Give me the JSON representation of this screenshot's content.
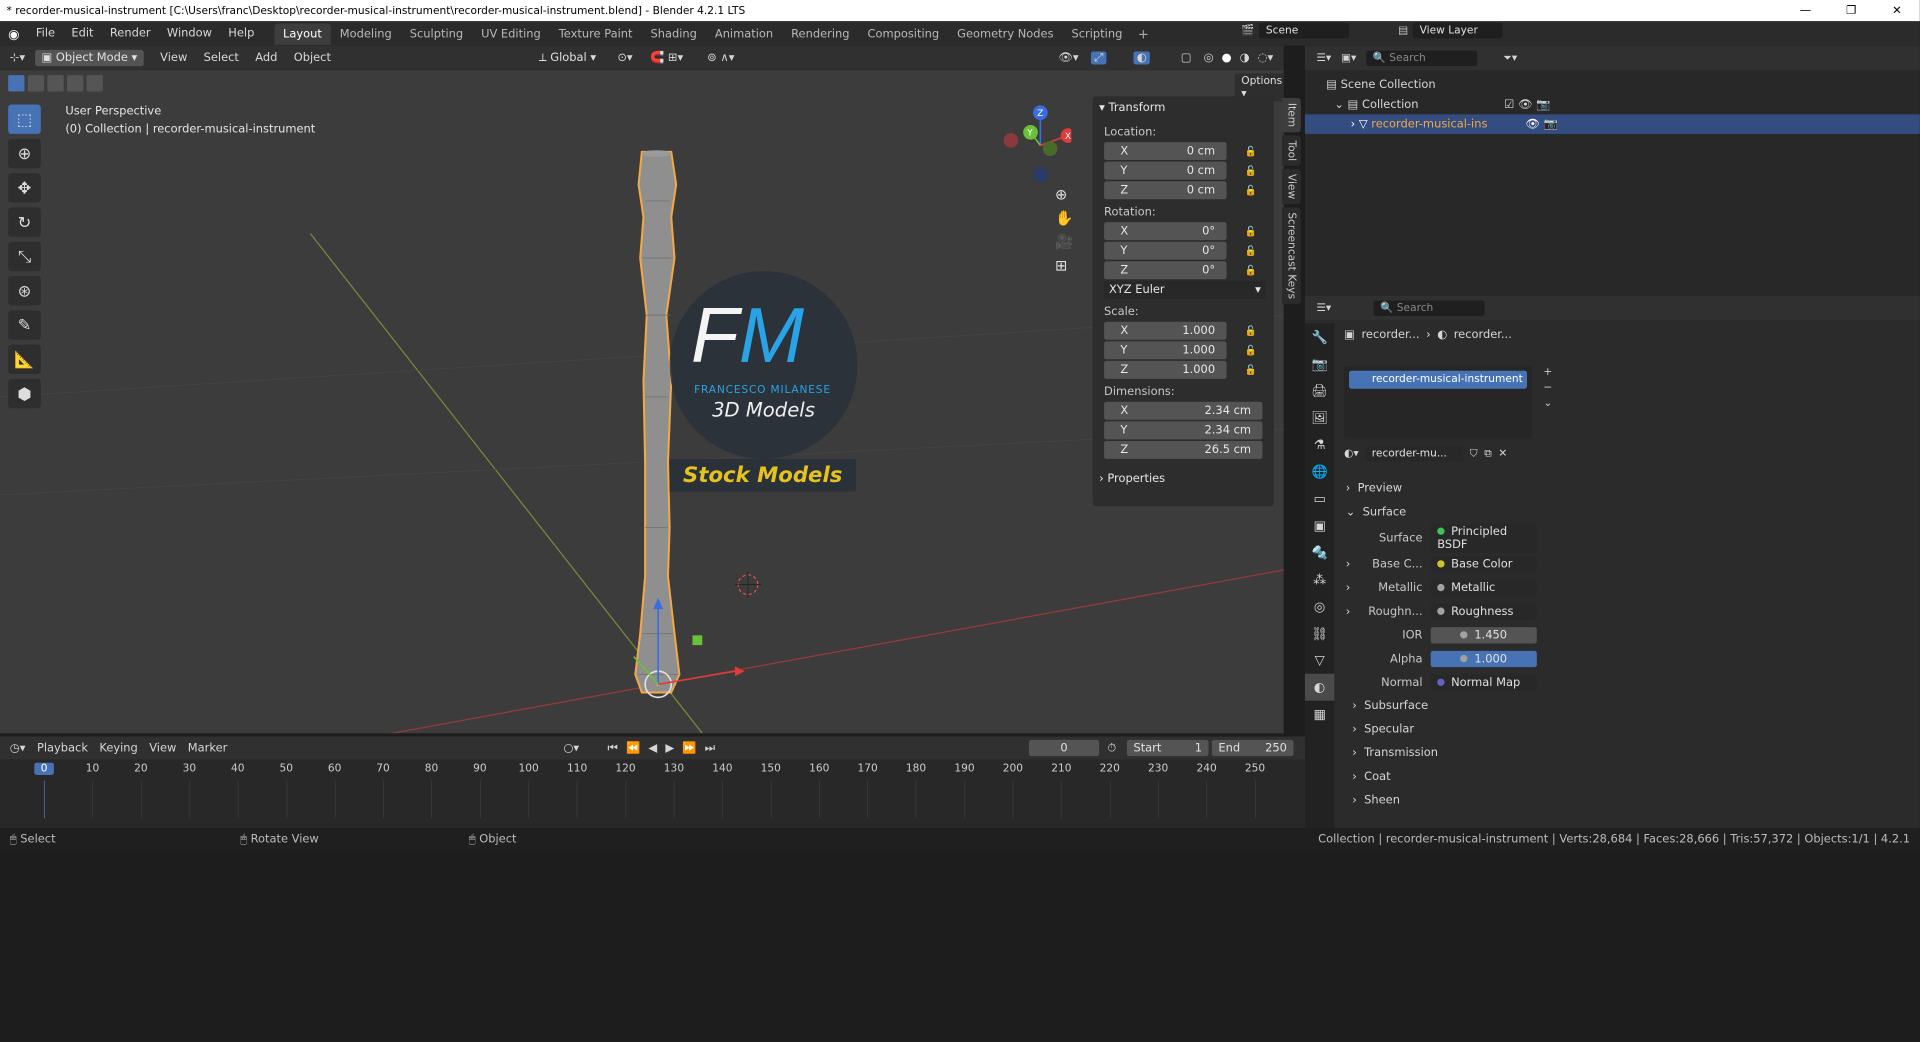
{
  "window": {
    "title": "* recorder-musical-instrument [C:\\Users\\franc\\Desktop\\recorder-musical-instrument\\recorder-musical-instrument.blend] - Blender 4.2.1 LTS",
    "min": "—",
    "max": "❐",
    "close": "✕"
  },
  "menu": [
    "File",
    "Edit",
    "Render",
    "Window",
    "Help"
  ],
  "workspaces": [
    "Layout",
    "Modeling",
    "Sculpting",
    "UV Editing",
    "Texture Paint",
    "Shading",
    "Animation",
    "Rendering",
    "Compositing",
    "Geometry Nodes",
    "Scripting"
  ],
  "active_workspace": "Layout",
  "scene": {
    "label": "Scene",
    "view_layer": "View Layer"
  },
  "viewport_header": {
    "mode": "Object Mode",
    "view": "View",
    "select": "Select",
    "add": "Add",
    "object": "Object",
    "transform": "Global",
    "options": "Options"
  },
  "viewport": {
    "perspective": "User Perspective",
    "collection_info": "(0) Collection | recorder-musical-instrument",
    "axis_x": "X",
    "axis_y": "Y",
    "axis_z": "Z"
  },
  "logo": {
    "initials_f": "F",
    "initials_m": "M",
    "name": "FRANCESCO MILANESE",
    "sub": "3D Models",
    "banner": "Stock Models"
  },
  "npanel": {
    "transform": "Transform",
    "location": "Location:",
    "loc": [
      {
        "axis": "X",
        "value": "0 cm"
      },
      {
        "axis": "Y",
        "value": "0 cm"
      },
      {
        "axis": "Z",
        "value": "0 cm"
      }
    ],
    "rotation": "Rotation:",
    "rot": [
      {
        "axis": "X",
        "value": "0°"
      },
      {
        "axis": "Y",
        "value": "0°"
      },
      {
        "axis": "Z",
        "value": "0°"
      }
    ],
    "rot_mode": "XYZ Euler",
    "scale": "Scale:",
    "scl": [
      {
        "axis": "X",
        "value": "1.000"
      },
      {
        "axis": "Y",
        "value": "1.000"
      },
      {
        "axis": "Z",
        "value": "1.000"
      }
    ],
    "dimensions": "Dimensions:",
    "dim": [
      {
        "axis": "X",
        "value": "2.34 cm"
      },
      {
        "axis": "Y",
        "value": "2.34 cm"
      },
      {
        "axis": "Z",
        "value": "26.5 cm"
      }
    ],
    "properties": "Properties",
    "tabs": [
      "Item",
      "Tool",
      "View",
      "Screencast Keys"
    ]
  },
  "outliner": {
    "search": "Search",
    "scene_collection": "Scene Collection",
    "collection": "Collection",
    "object": "recorder-musical-ins"
  },
  "properties": {
    "search": "Search",
    "breadcrumb_1": "recorder...",
    "breadcrumb_2": "recorder...",
    "material_slot": "recorder-musical-instrument",
    "material_name": "recorder-mu...",
    "preview": "Preview",
    "surface_section": "Surface",
    "surface_label": "Surface",
    "surface_value": "Principled BSDF",
    "rows": [
      {
        "label": "Base C...",
        "value": "Base Color",
        "socket": "#c7c729"
      },
      {
        "label": "Metallic",
        "value": "Metallic",
        "socket": "#a1a1a1"
      },
      {
        "label": "Roughn...",
        "value": "Roughness",
        "socket": "#a1a1a1"
      }
    ],
    "ior_label": "IOR",
    "ior_value": "1.450",
    "alpha_label": "Alpha",
    "alpha_value": "1.000",
    "normal_label": "Normal",
    "normal_value": "Normal Map",
    "sections": [
      "Subsurface",
      "Specular",
      "Transmission",
      "Coat",
      "Sheen"
    ]
  },
  "timeline": {
    "playback": "Playback",
    "keying": "Keying",
    "view": "View",
    "marker": "Marker",
    "current": "0",
    "start_label": "Start",
    "start": "1",
    "end_label": "End",
    "end": "250",
    "ticks": [
      "0",
      "10",
      "20",
      "30",
      "40",
      "50",
      "60",
      "70",
      "80",
      "90",
      "100",
      "110",
      "120",
      "130",
      "140",
      "150",
      "160",
      "170",
      "180",
      "190",
      "200",
      "210",
      "220",
      "230",
      "240",
      "250"
    ]
  },
  "status": {
    "select": "Select",
    "rotate": "Rotate View",
    "object": "Object",
    "stats": "Collection | recorder-musical-instrument | Verts:28,684 | Faces:28,666 | Tris:57,372 | Objects:1/1 | 4.2.1"
  },
  "colors": {
    "accent": "#4772b3",
    "selection": "#f0a848",
    "logo_blue": "#2aa3e6",
    "banner": "#e6c21f"
  }
}
